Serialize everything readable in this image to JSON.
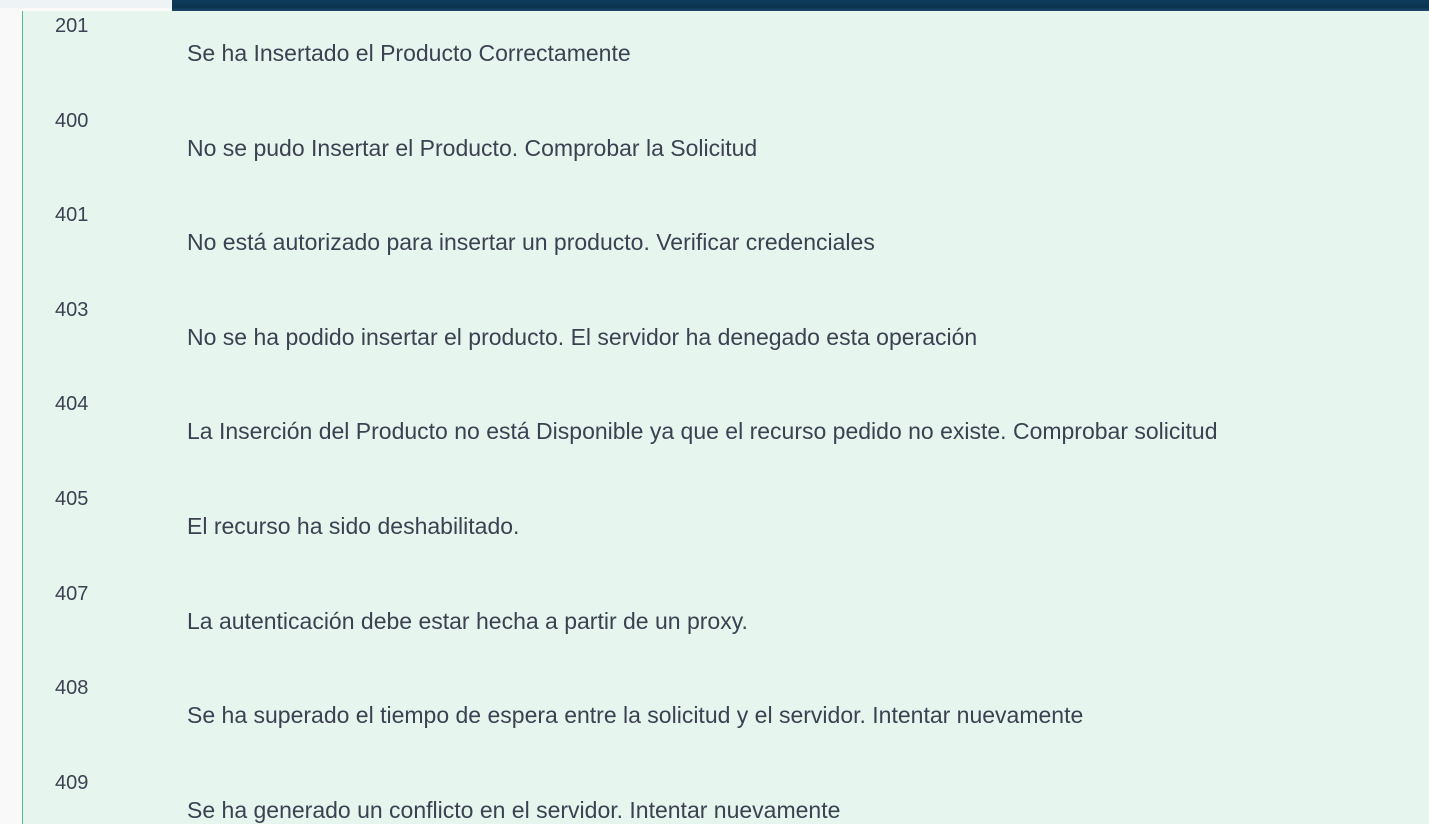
{
  "responses": [
    {
      "code": "201",
      "description": "Se ha Insertado el Producto Correctamente"
    },
    {
      "code": "400",
      "description": "No se pudo Insertar el Producto. Comprobar la Solicitud"
    },
    {
      "code": "401",
      "description": "No está autorizado para insertar un producto. Verificar credenciales"
    },
    {
      "code": "403",
      "description": "No se ha podido insertar el producto. El servidor ha denegado esta operación"
    },
    {
      "code": "404",
      "description": "La Inserción del Producto no está Disponible ya que el recurso pedido no existe. Comprobar solicitud"
    },
    {
      "code": "405",
      "description": "El recurso ha sido deshabilitado."
    },
    {
      "code": "407",
      "description": "La autenticación debe estar hecha a partir de un proxy."
    },
    {
      "code": "408",
      "description": "Se ha superado el tiempo de espera entre la solicitud y el servidor. Intentar nuevamente"
    },
    {
      "code": "409",
      "description": "Se ha generado un conflicto en el servidor. Intentar nuevamente"
    }
  ],
  "colors": {
    "panel_background": "#e6f6ee",
    "panel_border": "#58c08f",
    "text": "#3b4151",
    "top_bar": "#0e3c5c"
  }
}
